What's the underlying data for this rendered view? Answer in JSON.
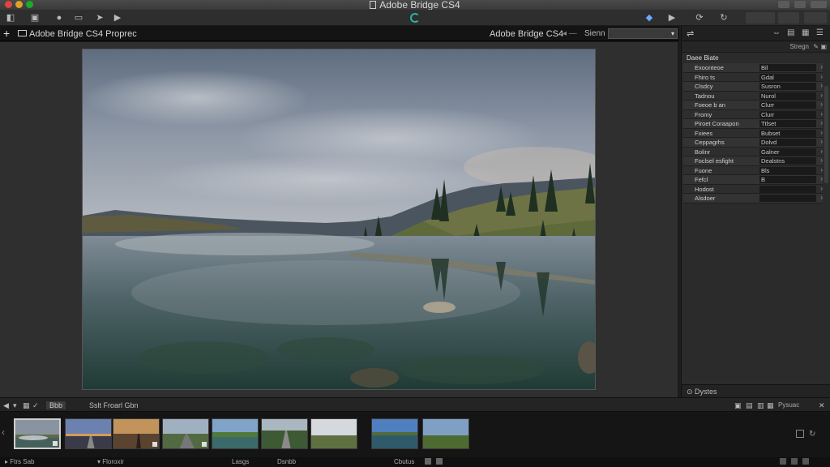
{
  "window": {
    "title": "Adobe Bridge CS4"
  },
  "pathbar": {
    "path": "Adobe Bridge CS4 Proprec",
    "right_title": "Adobe Bridge CS4",
    "scope": "Sienn",
    "select_value": ""
  },
  "metadata": {
    "sub_label": "Stregn",
    "section_title": "Daee Biate",
    "rows": [
      {
        "key": "Exoonteoe",
        "value": "Bil"
      },
      {
        "key": "Fhiro ts",
        "value": "Gdal"
      },
      {
        "key": "Clsdcy",
        "value": "Susron"
      },
      {
        "key": "Tadnou",
        "value": "Nurol"
      },
      {
        "key": "Foeoe b an",
        "value": "Clurr"
      },
      {
        "key": "Fromy",
        "value": "Clurr"
      },
      {
        "key": "Piroet Coraapon",
        "value": "Ttlset"
      },
      {
        "key": "Fxiees",
        "value": "Bubset"
      },
      {
        "key": "Ceppagrhs",
        "value": "Dolvd"
      },
      {
        "key": "Bolinr",
        "value": "Galner"
      },
      {
        "key": "Foclsel esfight",
        "value": "Dealstns"
      },
      {
        "key": "Fuone",
        "value": "Bls"
      },
      {
        "key": "Fefcl",
        "value": "B"
      },
      {
        "key": "Hodost",
        "value": ""
      },
      {
        "key": "Alsdoer",
        "value": ""
      }
    ],
    "bottom_label": "Dystes"
  },
  "filmbar": {
    "view_label": "Bbb",
    "title": "Sslt Froarl Gbn",
    "right_label": "Pysuac"
  },
  "filmstrip": {
    "thumbnails": [
      {
        "name": "lake-mist",
        "selected": true
      },
      {
        "name": "road-sunset",
        "selected": false
      },
      {
        "name": "desert-dusk",
        "selected": false
      },
      {
        "name": "valley-road",
        "selected": false
      },
      {
        "name": "green-lake",
        "selected": false
      },
      {
        "name": "forest-road",
        "selected": false
      },
      {
        "name": "meadow",
        "selected": false
      },
      {
        "name": "blue-lake",
        "selected": false
      },
      {
        "name": "plains",
        "selected": false
      }
    ]
  },
  "statusbar": {
    "left": "Ftrs Sab",
    "mid": "Floroxir",
    "right1": "Lasgs",
    "right2": "Dsnbb",
    "right3": "Cbutus"
  },
  "colors": {
    "accent_sync": "#2bb3a0",
    "background": "#2f2f2f"
  }
}
